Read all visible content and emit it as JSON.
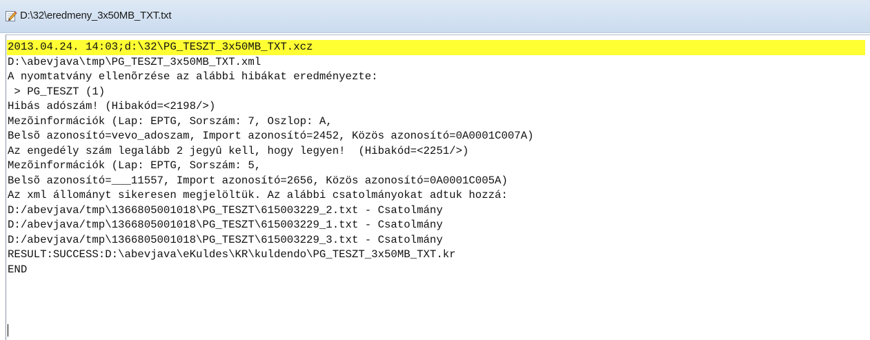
{
  "window": {
    "title": "D:\\32\\eredmeny_3x50MB_TXT.txt",
    "icon": "notepad-edit-icon"
  },
  "editor": {
    "highlight_color": "#ffff33",
    "lines": [
      "2013.04.24. 14:03;d:\\32\\PG_TESZT_3x50MB_TXT.xcz",
      "D:\\abevjava\\tmp\\PG_TESZT_3x50MB_TXT.xml",
      "A nyomtatvány ellenõrzése az alábbi hibákat eredményezte:",
      " > PG_TESZT (1)",
      "Hibás adószám! (Hibakód=<2198/>)",
      "Mezõinformációk (Lap: EPTG, Sorszám: 7, Oszlop: A,",
      "Belsõ azonosító=vevo_adoszam, Import azonosító=2452, Közös azonosító=0A0001C007A)",
      "Az engedély szám legalább 2 jegyû kell, hogy legyen!  (Hibakód=<2251/>)",
      "Mezõinformációk (Lap: EPTG, Sorszám: 5,",
      "Belsõ azonosító=___11557, Import azonosító=2656, Közös azonosító=0A0001C005A)",
      "Az xml állományt sikeresen megjelöltük. Az alábbi csatolmányokat adtuk hozzá:",
      "D:/abevjava/tmp\\1366805001018\\PG_TESZT\\615003229_2.txt - Csatolmány",
      "D:/abevjava/tmp\\1366805001018\\PG_TESZT\\615003229_1.txt - Csatolmány",
      "D:/abevjava/tmp\\1366805001018\\PG_TESZT\\615003229_3.txt - Csatolmány",
      "RESULT:SUCCESS:D:\\abevjava\\eKuldes\\KR\\kuldendo\\PG_TESZT_3x50MB_TXT.kr",
      "END"
    ]
  }
}
